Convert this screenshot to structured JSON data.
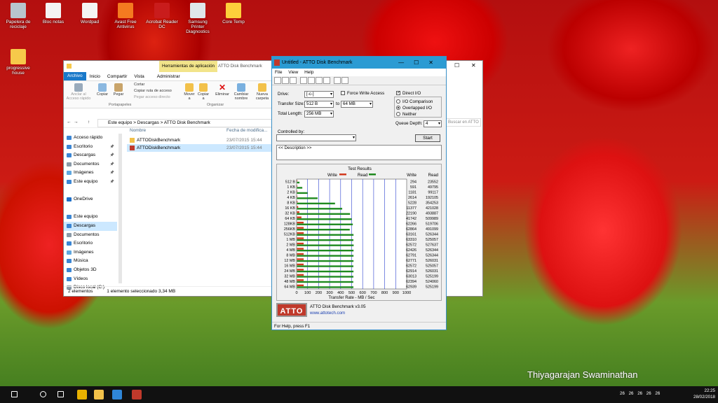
{
  "desktop_icons": [
    {
      "label": "Papelera de reciclaje",
      "icon": "recycle-bin-icon",
      "color": "#b8c4cc"
    },
    {
      "label": "Bloc notas",
      "icon": "notepad-icon",
      "color": "#f4f4f4"
    },
    {
      "label": "Wordpad",
      "icon": "wordpad-icon",
      "color": "#f4f4f4"
    },
    {
      "label": "Avast Free Antivirus",
      "icon": "avast-icon",
      "color": "#f47a20"
    },
    {
      "label": "Acrobat Reader DC",
      "icon": "acrobat-icon",
      "color": "#c91c1c"
    },
    {
      "label": "Samsung Printer Diagnostics",
      "icon": "printer-icon",
      "color": "#dfe6ea"
    },
    {
      "label": "Core Temp",
      "icon": "core-temp-icon",
      "color": "#fdd03b"
    },
    {
      "label": "progressive house",
      "icon": "folder-icon",
      "color": "#f6c94a"
    }
  ],
  "explorer": {
    "ribbon_tabs": [
      "Archivo",
      "Inicio",
      "Compartir",
      "Vista",
      "Administrar"
    ],
    "context_tab": "Herramientas de aplicación",
    "window_title": "ATTO Disk Benchmark",
    "ribbon": {
      "pin": "Anclar al Acceso rápido",
      "copy": "Copiar",
      "paste": "Pegar",
      "cut": "Cortar",
      "copy_path": "Copiar ruta de acceso",
      "paste_shortcut": "Pegar acceso directo",
      "group_clipboard": "Portapapeles",
      "move": "Mover a",
      "copy_to": "Copiar a",
      "delete": "Eliminar",
      "rename": "Cambiar nombre",
      "new_folder": "Nueva carpeta",
      "group_organize": "Organizar"
    },
    "breadcrumb": [
      "Este equipo",
      "Descargas",
      "ATTO Disk Benchmark"
    ],
    "search_placeholder": "Buscar en ATTO Disk Benchmark",
    "columns": {
      "name": "Nombre",
      "date": "Fecha de modifica..."
    },
    "files": [
      {
        "name": "ATTODiskBenchmark",
        "date": "23/07/2015 15:44",
        "icon": "folder-icon"
      },
      {
        "name": "ATTODiskBenchmark",
        "date": "23/07/2015 15:44",
        "icon": "app-icon",
        "selected": true
      }
    ],
    "nav": [
      {
        "label": "Acceso rápido",
        "icon": "star-icon",
        "color": "#3b86d4"
      },
      {
        "label": "Escritorio",
        "icon": "desktop-icon",
        "color": "#3b86d4",
        "pinned": true
      },
      {
        "label": "Descargas",
        "icon": "download-icon",
        "color": "#3b86d4",
        "pinned": true
      },
      {
        "label": "Documentos",
        "icon": "documents-icon",
        "color": "#8a9aa8",
        "pinned": true
      },
      {
        "label": "Imágenes",
        "icon": "pictures-icon",
        "color": "#5fa8e0",
        "pinned": true
      },
      {
        "label": "Este equipo",
        "icon": "computer-icon",
        "color": "#3b86d4",
        "pinned": true
      },
      {
        "label": "",
        "icon": "",
        "color": ""
      },
      {
        "label": "OneDrive",
        "icon": "onedrive-icon",
        "color": "#1e6fc8"
      },
      {
        "label": "",
        "icon": "",
        "color": ""
      },
      {
        "label": "Este equipo",
        "icon": "computer-icon",
        "color": "#3b86d4"
      },
      {
        "label": "Descargas",
        "icon": "download-icon",
        "color": "#3b86d4",
        "selected": true
      },
      {
        "label": "Documentos",
        "icon": "documents-icon",
        "color": "#8a9aa8"
      },
      {
        "label": "Escritorio",
        "icon": "desktop-icon",
        "color": "#3b86d4"
      },
      {
        "label": "Imágenes",
        "icon": "pictures-icon",
        "color": "#5fa8e0"
      },
      {
        "label": "Música",
        "icon": "music-icon",
        "color": "#3b86d4"
      },
      {
        "label": "Objetos 3D",
        "icon": "cube-icon",
        "color": "#3b86d4"
      },
      {
        "label": "Vídeos",
        "icon": "video-icon",
        "color": "#3b86d4"
      },
      {
        "label": "Disco local (C:)",
        "icon": "disk-icon",
        "color": "#8a9aa8"
      }
    ],
    "status_left": "2 elementos",
    "status_right": "1 elemento seleccionado 3,34 MB"
  },
  "atto": {
    "title": "Untitled - ATTO Disk Benchmark",
    "menu": [
      "File",
      "View",
      "Help"
    ],
    "drive_label": "Drive:",
    "drive_value": "[-c-]",
    "force_write": "Force Write Access",
    "direct_io": "Direct I/O",
    "transfer_label": "Transfer Size:",
    "transfer_from": "512 B",
    "to_label": "to",
    "transfer_to": "64 MB",
    "total_label": "Total Length:",
    "total_value": "256 MB",
    "io_comparison": "I/O Comparison",
    "overlapped": "Overlapped I/O",
    "neither": "Neither",
    "queue_label": "Queue Depth:",
    "queue_value": "4",
    "controlled_label": "Controlled by:",
    "start": "Start",
    "description": "<< Description >>",
    "results_title": "Test Results",
    "legend_write": "Write",
    "legend_read": "Read",
    "col_write": "Write",
    "col_read": "Read",
    "version": "ATTO Disk Benchmark v3.05",
    "url": "www.attotech.com",
    "logo_text": "ATTO",
    "status": "For Help, press F1",
    "write_color": "#d23a1e",
    "read_color": "#1f8a1f"
  },
  "chart_data": {
    "type": "bar",
    "title": "Test Results",
    "xlabel": "Transfer Rate - MB / Sec",
    "xlim": [
      0,
      1000
    ],
    "xticks": [
      0,
      100,
      200,
      300,
      400,
      500,
      600,
      700,
      800,
      900,
      1000
    ],
    "categories": [
      "512 B",
      "1 KB",
      "2 KB",
      "4 KB",
      "8 KB",
      "16 KB",
      "32 KB",
      "64 KB",
      "128KB",
      "256KB",
      "512KB",
      "1 MB",
      "2 MB",
      "4 MB",
      "8 MB",
      "12 MB",
      "16 MB",
      "24 MB",
      "32 MB",
      "48 MB",
      "64 MB"
    ],
    "series": [
      {
        "name": "Write",
        "values": [
          294,
          591,
          1181,
          2614,
          5228,
          11377,
          22190,
          41742,
          62266,
          62864,
          63161,
          63310,
          62572,
          62426,
          62791,
          62771,
          62572,
          62914,
          63013,
          62394,
          62939
        ]
      },
      {
        "name": "Read",
        "values": [
          23552,
          49795,
          99117,
          192105,
          354253,
          421028,
          493887,
          509989,
          519706,
          491099,
          526344,
          525057,
          527637,
          526344,
          526344,
          526031,
          525057,
          526031,
          525199,
          524060,
          525199
        ]
      }
    ]
  },
  "taskbar": {
    "time": "22:25",
    "date": "28/02/2018",
    "tray_nums": "26 26 26 26 26",
    "items": [
      {
        "icon": "start-icon",
        "color": "#ffffff"
      },
      {
        "icon": "search-icon",
        "color": "#ffffff"
      },
      {
        "icon": "task-view-icon",
        "color": "#ffffff"
      },
      {
        "icon": "chrome-icon",
        "color": "#e8b100"
      },
      {
        "icon": "explorer-icon",
        "color": "#f2c14a"
      },
      {
        "icon": "edge-icon",
        "color": "#2f86d8"
      },
      {
        "icon": "atto-icon",
        "color": "#c0392b"
      }
    ]
  },
  "watermark": "Thiyagarajan Swaminathan"
}
